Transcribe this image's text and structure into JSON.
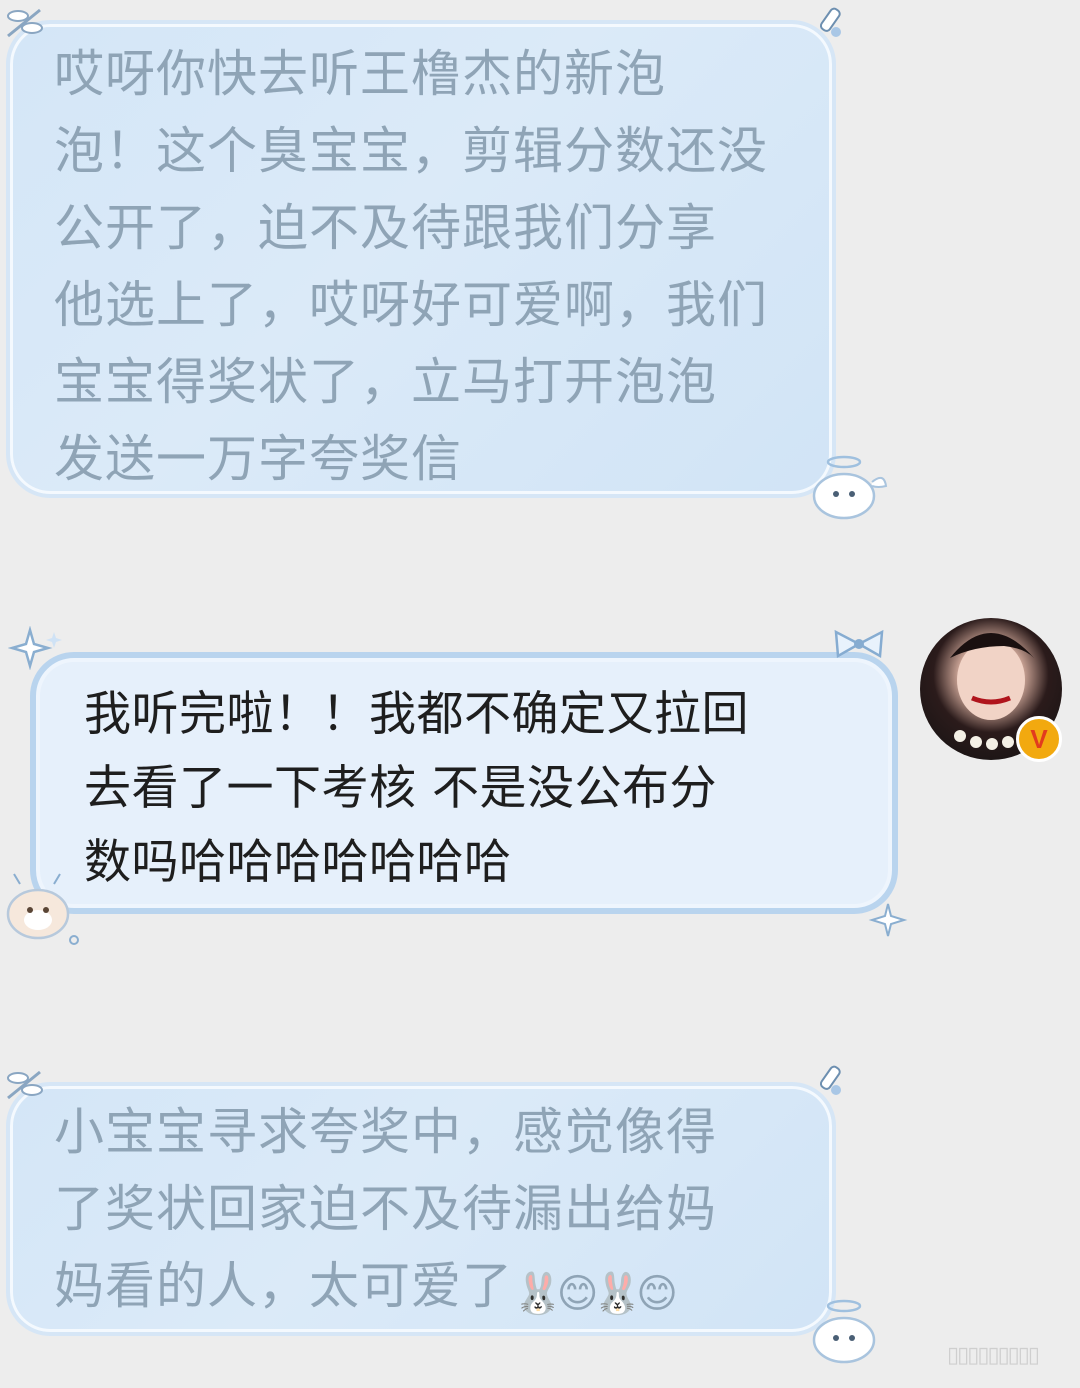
{
  "messages": [
    {
      "side": "left",
      "text": "哎呀你快去听王橹杰的新泡\n泡！这个臭宝宝，剪辑分数还没\n公开了，迫不及待跟我们分享\n他选上了，哎呀好可爱啊，我们\n宝宝得奖状了，立马打开泡泡\n发送一万字夸奖信"
    },
    {
      "side": "right",
      "text": "我听完啦！！我都不确定又拉回\n去看了一下考核 不是没公布分\n数吗哈哈哈哈哈哈哈",
      "avatar_badge": "V"
    },
    {
      "side": "left",
      "text": "小宝宝寻求夸奖中，感觉像得\n了奖状回家迫不及待漏出给妈\n妈看的人，太可爱了",
      "emoji": "🐰😊🐰😊"
    }
  ],
  "watermark": "▯▯▯▯▯▯▯▯▯",
  "colors": {
    "background": "#ededed",
    "bubble_left": "#d8e8f8",
    "bubble_right": "#e6f0fb",
    "faded_text": "#8fa4b6",
    "dark_text": "#1e1e1e",
    "badge": "#f2a90f"
  }
}
